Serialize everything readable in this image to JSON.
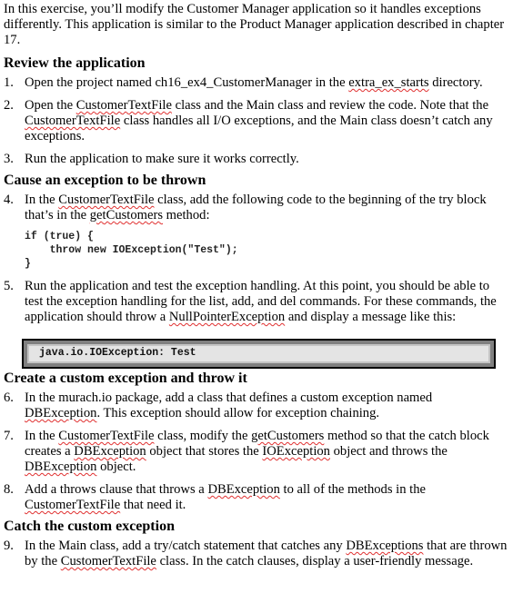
{
  "intro": "In this exercise, you’ll modify the Customer Manager application so it handles exceptions differently. This application is similar to the Product Manager application described in chapter 17.",
  "sections": [
    {
      "heading": "Review the application",
      "items": [
        {
          "num": "1.",
          "parts": [
            "Open the project named ch16_ex4_CustomerManager in the ",
            "extra_ex_starts",
            " directory."
          ]
        },
        {
          "num": "2.",
          "parts": [
            "Open the ",
            "CustomerTextFile",
            " class and the Main class and review the code. Note that the ",
            "CustomerTextFile",
            " class handles all I/O exceptions, and the Main class doesn’t catch any exceptions."
          ]
        },
        {
          "num": "3.",
          "parts": [
            "Run the application to make sure it works correctly."
          ]
        }
      ]
    },
    {
      "heading": "Cause an exception to be thrown",
      "items": [
        {
          "num": "4.",
          "parts": [
            "In the ",
            "CustomerTextFile",
            " class, add the following code to the beginning of the try block that’s in the ",
            "getCustomers",
            " method:"
          ]
        },
        {
          "num": "5.",
          "parts": [
            "Run the application and test the exception handling. At this point, you should be able to test the exception handling for the list, add, and del commands. For these commands, the application should throw a ",
            "NullPointerException",
            " and display a message like this:"
          ]
        }
      ],
      "code_lines": [
        "if (true) {",
        "    throw new IOException(\"Test\");",
        "}"
      ],
      "console_output": "java.io.IOException: Test"
    },
    {
      "heading": "Create a custom exception and throw it",
      "items": [
        {
          "num": "6.",
          "parts": [
            "In the murach.io package, add a class that defines a custom exception named ",
            "DBException",
            ". This exception should allow for exception chaining."
          ]
        },
        {
          "num": "7.",
          "parts": [
            "In the ",
            "CustomerTextFile",
            " class, modify the ",
            "getCustomers",
            " method so that the catch block creates a ",
            "DBException",
            " object that stores the ",
            "IOException",
            " object and throws the ",
            "DBException",
            " object."
          ]
        },
        {
          "num": "8.",
          "parts": [
            "Add a throws clause that throws a ",
            "DBException",
            " to all of the methods in the ",
            "CustomerTextFile",
            " that need it."
          ]
        }
      ]
    },
    {
      "heading": "Catch the custom exception",
      "items": [
        {
          "num": "9.",
          "parts": [
            "In the Main class, add a try/catch statement that catches any ",
            "DBExceptions",
            " that are thrown by the ",
            "CustomerTextFile",
            " class. In the catch clauses, display a user-friendly message."
          ]
        }
      ]
    }
  ]
}
